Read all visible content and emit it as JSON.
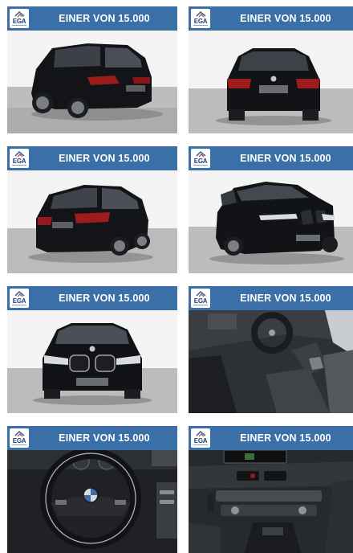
{
  "banner": {
    "logo_text": "EGA",
    "label": "EINER VON 15.000"
  },
  "tiles": [
    {
      "photo": "car-rear-three-quarter-left"
    },
    {
      "photo": "car-rear"
    },
    {
      "photo": "car-rear-three-quarter-right"
    },
    {
      "photo": "car-front-three-quarter"
    },
    {
      "photo": "car-front"
    },
    {
      "photo": "car-interior-seats"
    },
    {
      "photo": "car-steering-wheel"
    },
    {
      "photo": "car-center-console"
    }
  ],
  "colors": {
    "banner": "#3a6fa8",
    "car_body": "#101318",
    "studio_wall": "#f3f3f3",
    "studio_floor": "#b9b9b9"
  }
}
